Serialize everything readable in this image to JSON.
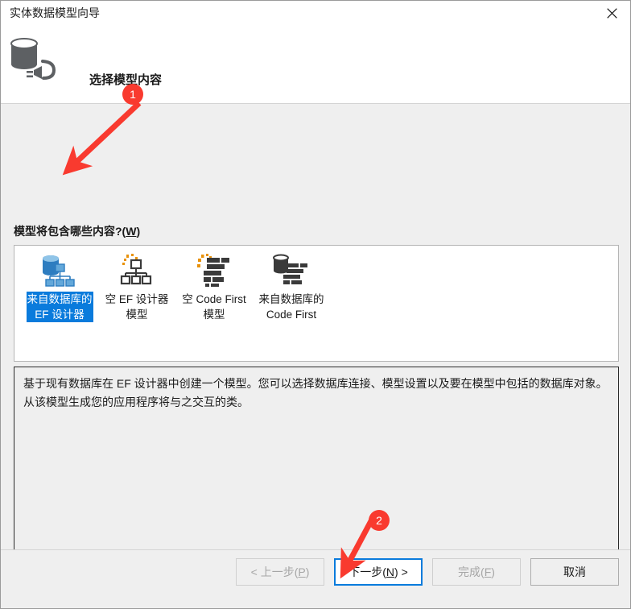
{
  "window": {
    "title": "实体数据模型向导",
    "close_label": "×",
    "header_icon": "database-plug-icon",
    "header_title": "选择模型内容"
  },
  "prompt": {
    "text_before": "模型将包含哪些内容?(",
    "accel": "W",
    "text_after": ")"
  },
  "options": [
    {
      "id": "ef-designer-from-database",
      "label": "来自数据库的\nEF 设计器",
      "icon": "database-hierarchy-blue-icon",
      "selected": true
    },
    {
      "id": "empty-ef-designer-model",
      "label": "空 EF 设计器\n模型",
      "icon": "hierarchy-sparkle-icon",
      "selected": false
    },
    {
      "id": "empty-code-first-model",
      "label": "空 Code First\n模型",
      "icon": "code-lines-sparkle-icon",
      "selected": false
    },
    {
      "id": "code-first-from-database",
      "label": "来自数据库的\nCode First",
      "icon": "database-code-lines-icon",
      "selected": false
    }
  ],
  "description": {
    "text": "基于现有数据库在 EF 设计器中创建一个模型。您可以选择数据库连接、模型设置以及要在模型中包括的数据库对象。从该模型生成您的应用程序将与之交互的类。"
  },
  "buttons": {
    "back": {
      "prefix": "< 上一步(",
      "accel": "P",
      "suffix": ")",
      "state": "disabled"
    },
    "next": {
      "prefix": "下一步(",
      "accel": "N",
      "suffix": ") >",
      "state": "focused"
    },
    "finish": {
      "prefix": "完成(",
      "accel": "F",
      "suffix": ")",
      "state": "disabled"
    },
    "cancel": {
      "prefix": "取消",
      "accel": "",
      "suffix": "",
      "state": "enabled"
    }
  },
  "annotations": {
    "marker1": "1",
    "marker2": "2",
    "color": "#f93a2f"
  }
}
